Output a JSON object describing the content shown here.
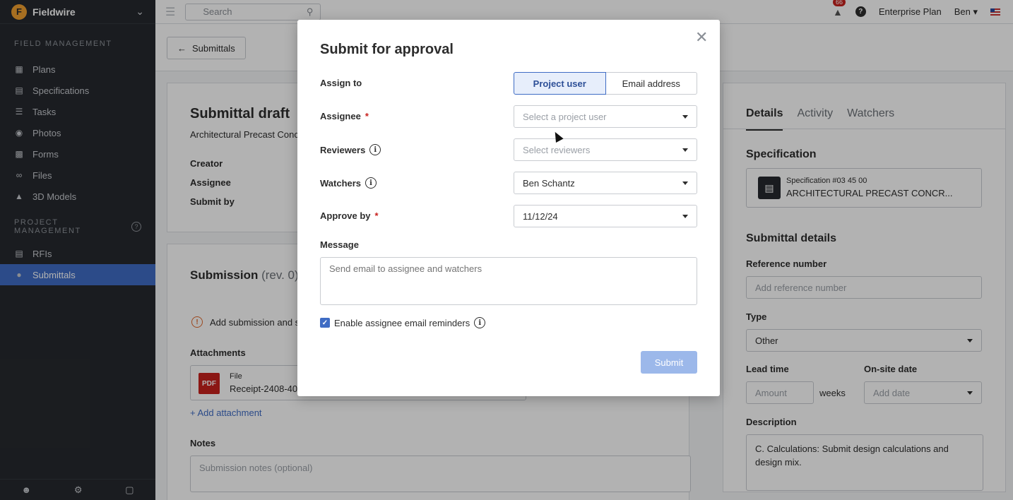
{
  "app": {
    "name": "Fieldwire"
  },
  "sidebar": {
    "field_management_title": "FIELD MANAGEMENT",
    "field_items": [
      {
        "label": "Plans",
        "icon": "plans-icon"
      },
      {
        "label": "Specifications",
        "icon": "specifications-icon"
      },
      {
        "label": "Tasks",
        "icon": "tasks-icon"
      },
      {
        "label": "Photos",
        "icon": "camera-icon"
      },
      {
        "label": "Forms",
        "icon": "forms-icon"
      },
      {
        "label": "Files",
        "icon": "paperclip-icon"
      },
      {
        "label": "3D Models",
        "icon": "cube-icon"
      }
    ],
    "project_management_title": "PROJECT MANAGEMENT",
    "project_items": [
      {
        "label": "RFIs",
        "icon": "rfi-icon"
      },
      {
        "label": "Submittals",
        "icon": "submittals-icon",
        "active": true
      }
    ]
  },
  "topbar": {
    "search_placeholder": "Search",
    "notifications_count": "66",
    "plan_label": "Enterprise Plan",
    "user_label": "Ben"
  },
  "page": {
    "back_label": "Submittals",
    "draft_title": "Submittal draft",
    "draft_subtitle": "Architectural Precast Conc",
    "creator_label": "Creator",
    "assignee_label": "Assignee",
    "submit_by_label": "Submit by",
    "submission_title": "Submission",
    "submission_rev": "(rev. 0)",
    "warning_text": "Add submission and su",
    "attachments_label": "Attachments",
    "file_type": "File",
    "file_name": "Receipt-2408-40",
    "pdf_tag": "PDF",
    "add_attachment": "+ Add attachment",
    "notes_label": "Notes",
    "notes_placeholder": "Submission notes (optional)"
  },
  "details_panel": {
    "tabs": [
      "Details",
      "Activity",
      "Watchers"
    ],
    "spec_heading": "Specification",
    "spec_number": "Specification #03 45 00",
    "spec_name": "ARCHITECTURAL PRECAST CONCR...",
    "submittal_details_heading": "Submittal details",
    "reference_label": "Reference number",
    "reference_placeholder": "Add reference number",
    "type_label": "Type",
    "type_value": "Other",
    "lead_time_label": "Lead time",
    "lead_time_placeholder": "Amount",
    "lead_time_unit": "weeks",
    "onsite_label": "On-site date",
    "onsite_placeholder": "Add date",
    "description_label": "Description",
    "description_value": "C. Calculations:  Submit design calculations and design mix."
  },
  "modal": {
    "title": "Submit for approval",
    "assign_to_label": "Assign to",
    "assign_options": [
      "Project user",
      "Email address"
    ],
    "assign_selected": "Project user",
    "assignee_label": "Assignee",
    "assignee_placeholder": "Select a project user",
    "reviewers_label": "Reviewers",
    "reviewers_placeholder": "Select reviewers",
    "watchers_label": "Watchers",
    "watchers_value": "Ben Schantz",
    "approve_by_label": "Approve by",
    "approve_by_value": "11/12/24",
    "message_label": "Message",
    "message_placeholder": "Send email to assignee and watchers",
    "reminder_label": "Enable assignee email reminders",
    "reminder_checked": true,
    "submit_label": "Submit",
    "required_mark": "*"
  },
  "colors": {
    "sidebar_bg": "#26292e",
    "accent": "#3f6cc4",
    "submit_disabled": "#9cb8ea",
    "badge": "#c8211e",
    "warning": "#e0692e"
  }
}
